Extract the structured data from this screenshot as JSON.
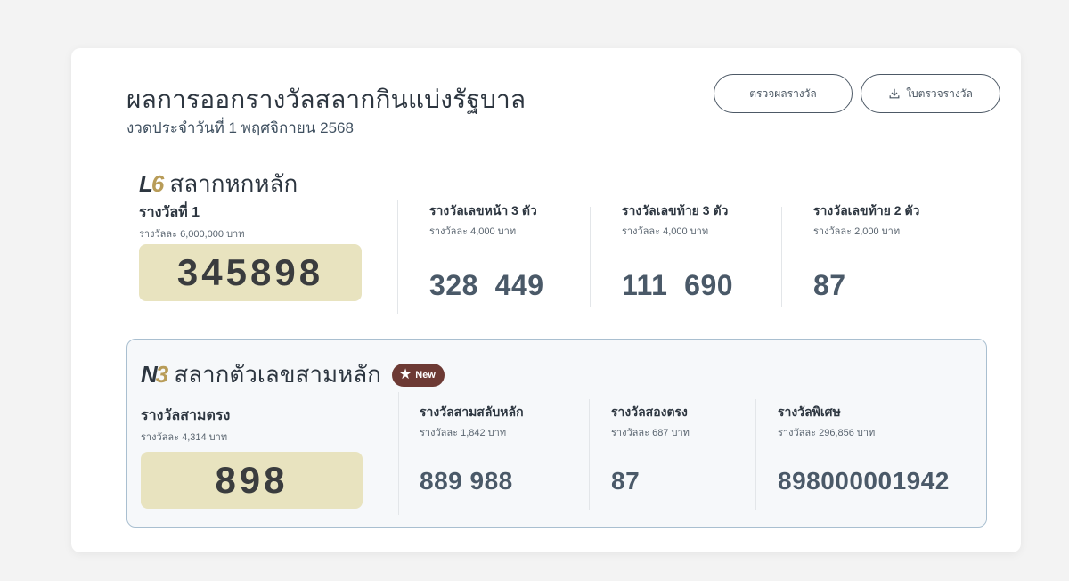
{
  "header": {
    "title": "ผลการออกรางวัลสลากกินแบ่งรัฐบาล",
    "subtitle": "งวดประจำวันที่ 1 พฤศจิกายน 2568",
    "check_button": "ตรวจผลรางวัล",
    "download_button": "ใบตรวจรางวัล"
  },
  "six_digit": {
    "logo_letter": "L",
    "logo_num": "6",
    "name": "สลากหกหลัก",
    "first_prize": {
      "title": "รางวัลที่ 1",
      "sub": "รางวัลละ 6,000,000 บาท",
      "number": "345898"
    },
    "columns": [
      {
        "title": "รางวัลเลขหน้า 3 ตัว",
        "sub": "รางวัลละ 4,000 บาท",
        "value": "328  449"
      },
      {
        "title": "รางวัลเลขท้าย 3 ตัว",
        "sub": "รางวัลละ 4,000 บาท",
        "value": "111  690"
      },
      {
        "title": "รางวัลเลขท้าย 2 ตัว",
        "sub": "รางวัลละ 2,000 บาท",
        "value": "87"
      }
    ]
  },
  "three_digit": {
    "logo_letter": "N",
    "logo_num": "3",
    "name": "สลากตัวเลขสามหลัก",
    "badge": "New",
    "main_prize": {
      "title": "รางวัลสามตรง",
      "sub": "รางวัลละ 4,314 บาท",
      "number": "898"
    },
    "columns": [
      {
        "title": "รางวัลสามสลับหลัก",
        "sub": "รางวัลละ 1,842 บาท",
        "value": "889 988"
      },
      {
        "title": "รางวัลสองตรง",
        "sub": "รางวัลละ 687 บาท",
        "value": "87"
      },
      {
        "title": "รางวัลพิเศษ",
        "sub": "รางวัลละ 296,856 บาท",
        "value": "898000001942"
      }
    ]
  },
  "colors": {
    "highlight_box": "#e8e3bf",
    "badge": "#6d3a34",
    "logo_accent": "#b89c58"
  }
}
